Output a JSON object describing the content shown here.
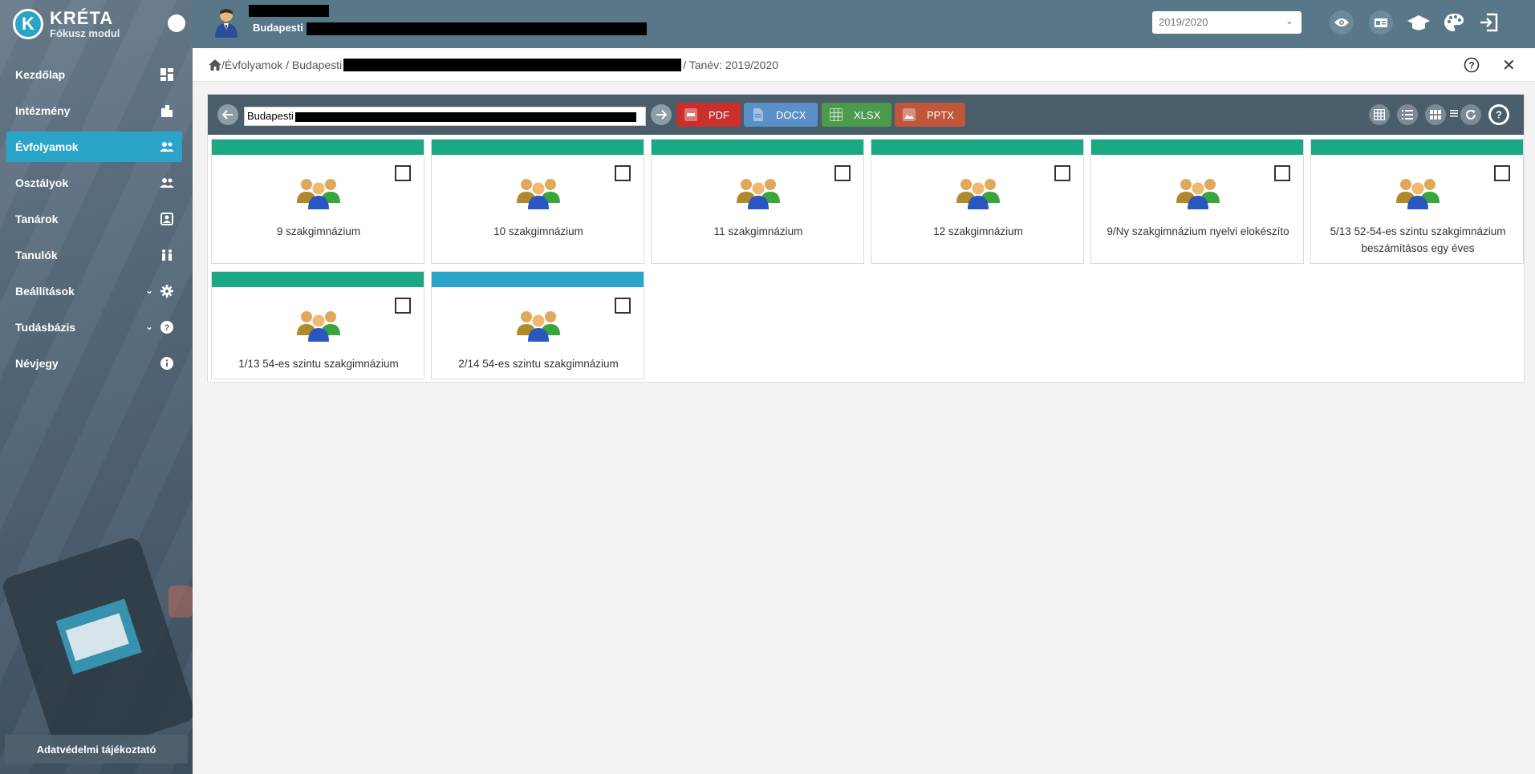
{
  "app": {
    "title": "KRÉTA",
    "subtitle": "Fókusz modul"
  },
  "sidebar": {
    "items": [
      {
        "label": "Kezdőlap",
        "icon": "dashboard-icon"
      },
      {
        "label": "Intézmény",
        "icon": "building-icon"
      },
      {
        "label": "Évfolyamok",
        "icon": "group-icon",
        "active": true
      },
      {
        "label": "Osztályok",
        "icon": "group-icon"
      },
      {
        "label": "Tanárok",
        "icon": "teacher-card-icon"
      },
      {
        "label": "Tanulók",
        "icon": "students-icon"
      },
      {
        "label": "Beállítások",
        "icon": "gear-icon",
        "expandable": true
      },
      {
        "label": "Tudásbázis",
        "icon": "help-icon",
        "expandable": true
      },
      {
        "label": "Névjegy",
        "icon": "info-icon"
      }
    ],
    "privacy_button": "Adatvédelmi tájékoztató"
  },
  "header": {
    "school_prefix": "Budapesti",
    "year_select": {
      "value": "2019/2020"
    },
    "buttons": [
      "eye-icon",
      "id-card-icon",
      "graduation-cap-icon",
      "palette-icon",
      "logout-icon"
    ]
  },
  "breadcrumb": {
    "part1": "/Évfolyamok / Budapesti",
    "part2": "/ Tanév: 2019/2020"
  },
  "toolbar": {
    "input_prefix": "Budapesti",
    "exports": [
      {
        "label": "PDF",
        "color": "#c9302c"
      },
      {
        "label": "DOCX",
        "color": "#5b8fc7"
      },
      {
        "label": "XLSX",
        "color": "#4c9a4c"
      },
      {
        "label": "PPTX",
        "color": "#c0573d"
      }
    ]
  },
  "grades": [
    {
      "label": "9 szakgimnázium",
      "color": "#1ba885"
    },
    {
      "label": "10 szakgimnázium",
      "color": "#1ba885"
    },
    {
      "label": "11 szakgimnázium",
      "color": "#1ba885"
    },
    {
      "label": "12 szakgimnázium",
      "color": "#1ba885"
    },
    {
      "label": "9/Ny szakgimnázium nyelvi elokészíto",
      "color": "#1ba885"
    },
    {
      "label": "5/13 52-54-es szintu szakgimnázium beszámításos egy éves",
      "color": "#1ba885"
    },
    {
      "label": "1/13 54-es szintu szakgimnázium",
      "color": "#1ba885"
    },
    {
      "label": "2/14 54-es szintu szakgimnázium",
      "color": "#2aa5c9"
    }
  ]
}
